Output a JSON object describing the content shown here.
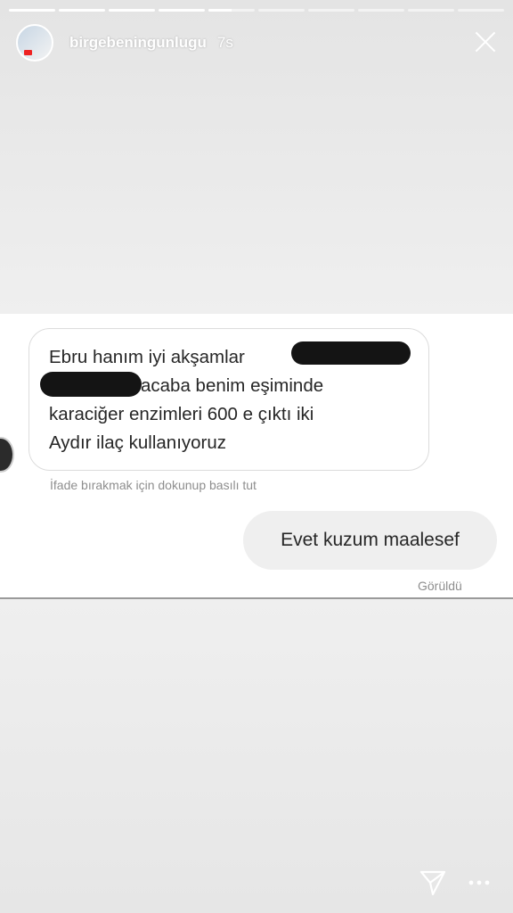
{
  "story": {
    "username": "birgebeningunlugu",
    "time_ago": "7s",
    "progress": [
      1,
      1,
      1,
      1,
      0.5,
      0,
      0,
      0,
      0,
      0
    ]
  },
  "conversation": {
    "incoming_lines": [
      "Ebru hanım iyi akşamlar",
      "acaba benim eşiminde",
      "karaciğer enzimleri 600 e çıktı iki",
      "Aydır ilaç kullanıyoruz"
    ],
    "react_hint": "İfade bırakmak için dokunup basılı tut",
    "reply": "Evet kuzum maalesef",
    "seen_label": "Görüldü"
  },
  "icons": {
    "close": "close-icon",
    "send": "send-icon",
    "more": "more-options-icon"
  },
  "colors": {
    "story_background": "#ededed",
    "bubble_border": "#dcdcdc",
    "reply_bubble": "#efefef",
    "redaction": "#141414"
  }
}
